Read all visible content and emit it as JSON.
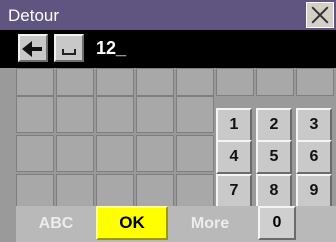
{
  "window": {
    "title": "Detour",
    "close_icon": "close-icon"
  },
  "entry": {
    "backspace_icon": "backspace-arrow-icon",
    "space_icon": "space-icon",
    "text": "12_"
  },
  "keypad": {
    "row1": [
      "1",
      "2",
      "3"
    ],
    "row2": [
      "4",
      "5",
      "6"
    ],
    "row3": [
      "7",
      "8",
      "9"
    ]
  },
  "bottom": {
    "abc": "ABC",
    "ok": "OK",
    "more": "More",
    "zero": "0"
  },
  "colors": {
    "title_bar": "#5f5580",
    "ok_button": "#ffff00",
    "entry_bar": "#000000"
  }
}
